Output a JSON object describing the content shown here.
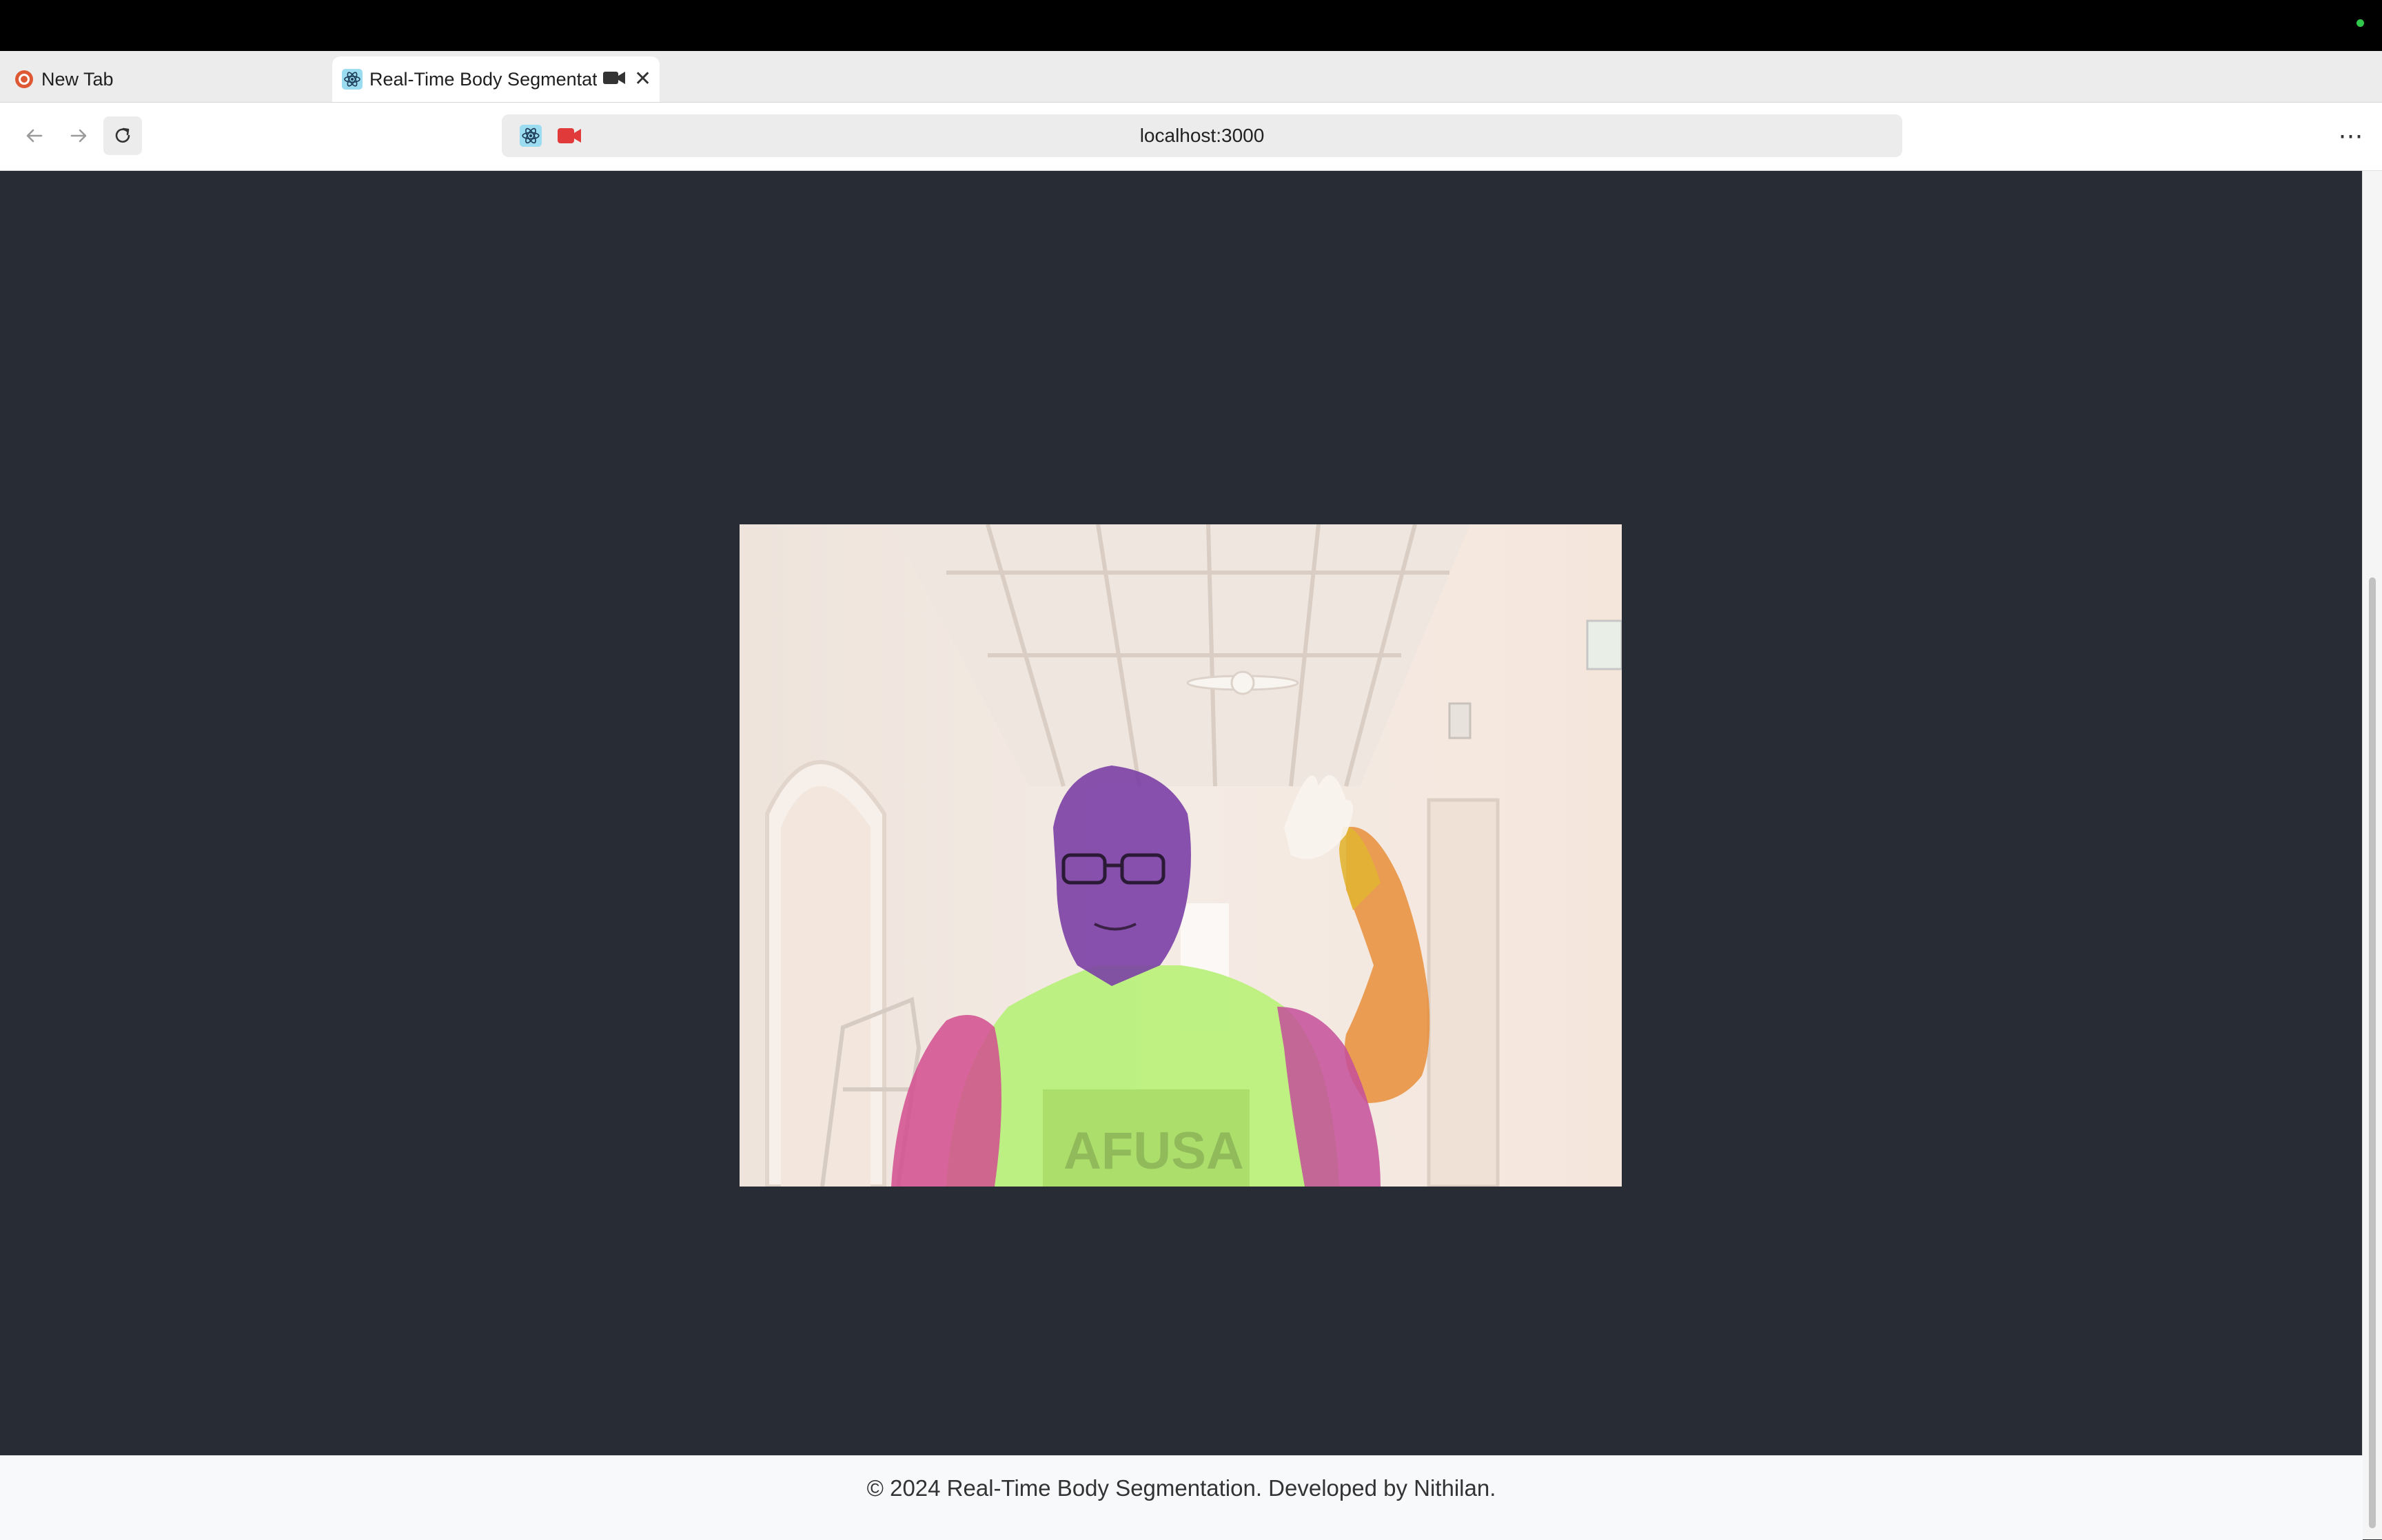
{
  "browser": {
    "tabs": [
      {
        "title": "New Tab",
        "icon": "duckduckgo-icon",
        "active": false
      },
      {
        "title": "Real-Time Body Segmentat",
        "icon": "react-icon",
        "active": true,
        "recording": true
      }
    ],
    "new_tab_symbol": "+",
    "close_symbol": "✕",
    "url": "localhost:3000",
    "menu_symbol": "⋯"
  },
  "footer": {
    "text": "© 2024 Real-Time Body Segmentation. Developed by Nithilan."
  },
  "segmentation": {
    "colors": {
      "head": "#7a3fa5",
      "torso": "#b8f079",
      "left_arm": "#d24d8f",
      "right_upper_arm": "#e9893b",
      "right_forearm": "#e0b02c"
    }
  },
  "colors": {
    "page_background": "#282c34",
    "footer_background": "#f8f9fa",
    "recording": "#e03a3a"
  }
}
